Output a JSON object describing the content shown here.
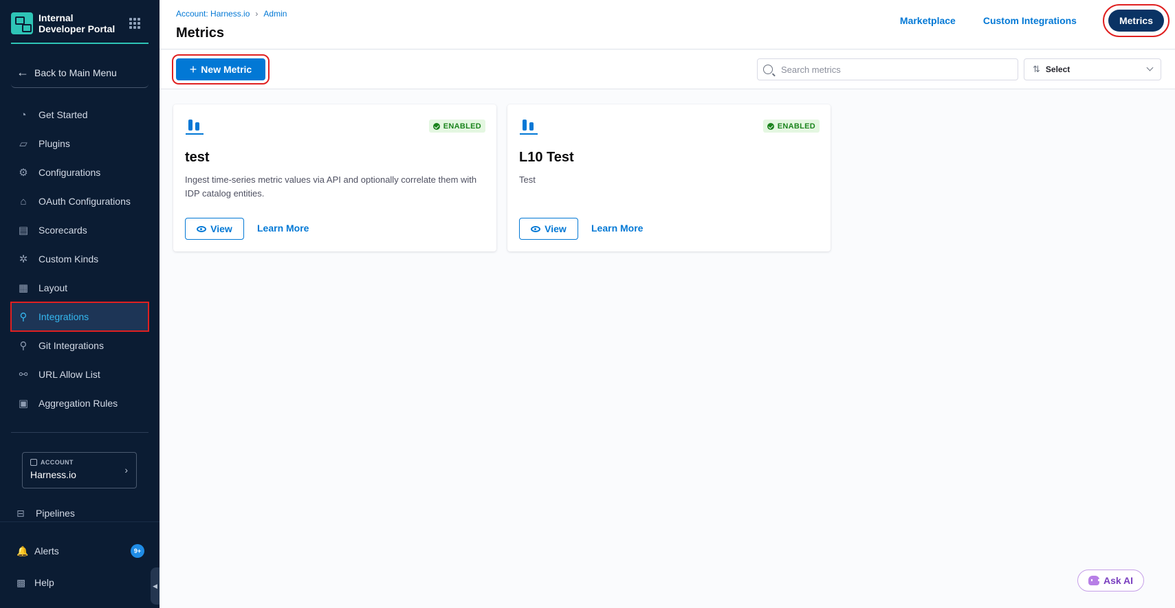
{
  "sidebar": {
    "brand_title": "Internal Developer Portal",
    "back_label": "Back to Main Menu",
    "items": [
      {
        "label": "Get Started",
        "icon": "get-started-icon"
      },
      {
        "label": "Plugins",
        "icon": "plugins-icon"
      },
      {
        "label": "Configurations",
        "icon": "gear-icon"
      },
      {
        "label": "OAuth Configurations",
        "icon": "lock-icon"
      },
      {
        "label": "Scorecards",
        "icon": "scorecard-icon"
      },
      {
        "label": "Custom Kinds",
        "icon": "settings-icon"
      },
      {
        "label": "Layout",
        "icon": "layout-icon"
      },
      {
        "label": "Integrations",
        "icon": "integrations-icon",
        "active": true
      },
      {
        "label": "Git Integrations",
        "icon": "git-icon"
      },
      {
        "label": "URL Allow List",
        "icon": "link-icon"
      },
      {
        "label": "Aggregation Rules",
        "icon": "aggregation-icon"
      }
    ],
    "account": {
      "label": "ACCOUNT",
      "name": "Harness.io"
    },
    "pipelines_label": "Pipelines",
    "alerts_label": "Alerts",
    "alerts_badge": "9+",
    "help_label": "Help"
  },
  "header": {
    "breadcrumb": [
      "Account: Harness.io",
      "Admin"
    ],
    "title": "Metrics",
    "tabs": [
      {
        "label": "Marketplace"
      },
      {
        "label": "Custom Integrations"
      },
      {
        "label": "Metrics",
        "active": true
      }
    ]
  },
  "toolbar": {
    "new_metric_label": "New Metric",
    "search_placeholder": "Search metrics",
    "sort_label": "Select"
  },
  "cards": [
    {
      "title": "test",
      "status": "ENABLED",
      "description": "Ingest time-series metric values via API and optionally correlate them with IDP catalog entities.",
      "view_label": "View",
      "learn_more_label": "Learn More"
    },
    {
      "title": "L10 Test",
      "status": "ENABLED",
      "description": "Test",
      "view_label": "View",
      "learn_more_label": "Learn More"
    }
  ],
  "ask_ai_label": "Ask AI",
  "colors": {
    "sidebar_bg": "#0b1c33",
    "accent": "#0278d5",
    "teal": "#2ec4b6",
    "enabled_green": "#1b841d",
    "highlight_red": "#e02020"
  }
}
